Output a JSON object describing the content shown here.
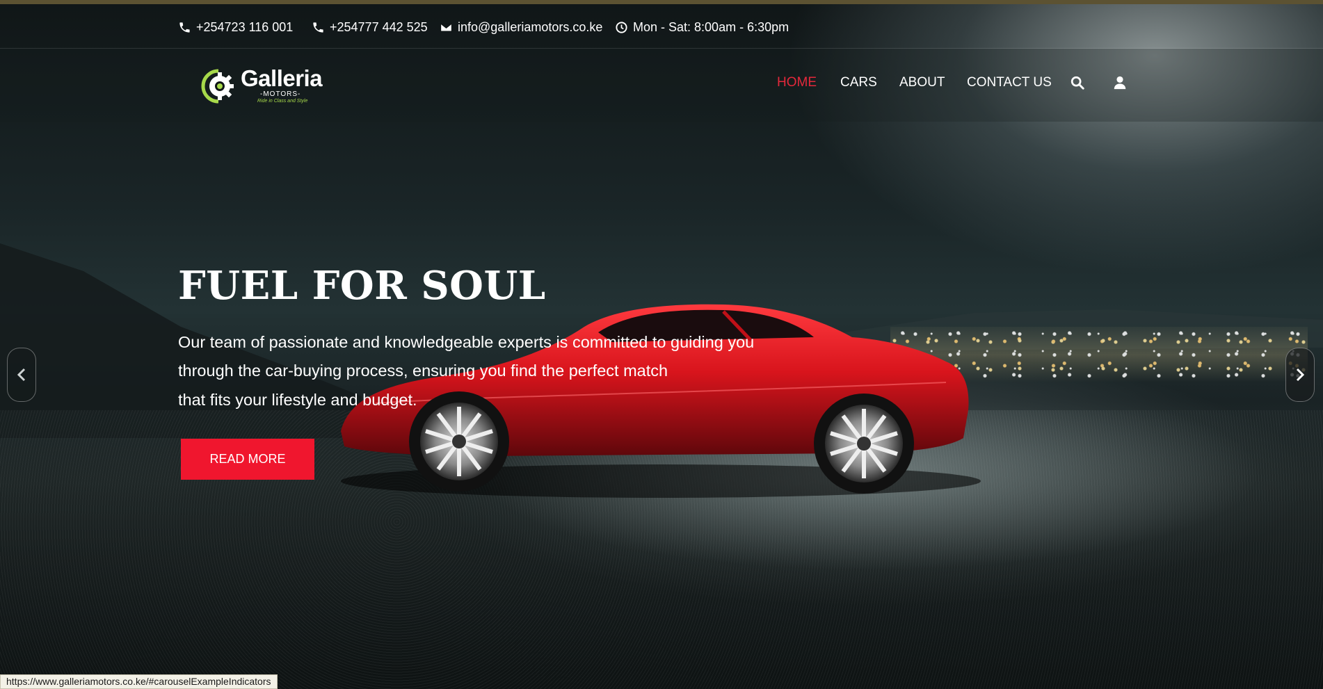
{
  "topbar": {
    "phone1": "+254723 116 001",
    "phone2": "+254777 442 525",
    "email": "info@galleriamotors.co.ke",
    "hours": "Mon - Sat: 8:00am - 6:30pm"
  },
  "logo": {
    "name": "Galleria",
    "sub": "-MOTORS-",
    "tagline": "Ride in Class and Style"
  },
  "nav": {
    "items": [
      "HOME",
      "CARS",
      "ABOUT",
      "CONTACT US"
    ],
    "active": "HOME"
  },
  "hero": {
    "title": "FUEL FOR SOUL",
    "lines": [
      "Our team of passionate and knowledgeable experts is committed to guiding you",
      "through the car-buying process, ensuring you find the perfect match",
      "that fits your lifestyle and budget."
    ],
    "button": "READ MORE"
  },
  "status_url": "https://www.galleriamotors.co.ke/#carouselExampleIndicators",
  "colors": {
    "accent": "#e3283b",
    "button": "#f0162e",
    "logo_green": "#a7d94a"
  },
  "icons": {
    "phone": "phone-icon",
    "email": "envelope-icon",
    "hours": "clock-icon",
    "search": "search-icon",
    "user": "user-icon",
    "prev": "chevron-left-icon",
    "next": "chevron-right-icon"
  }
}
